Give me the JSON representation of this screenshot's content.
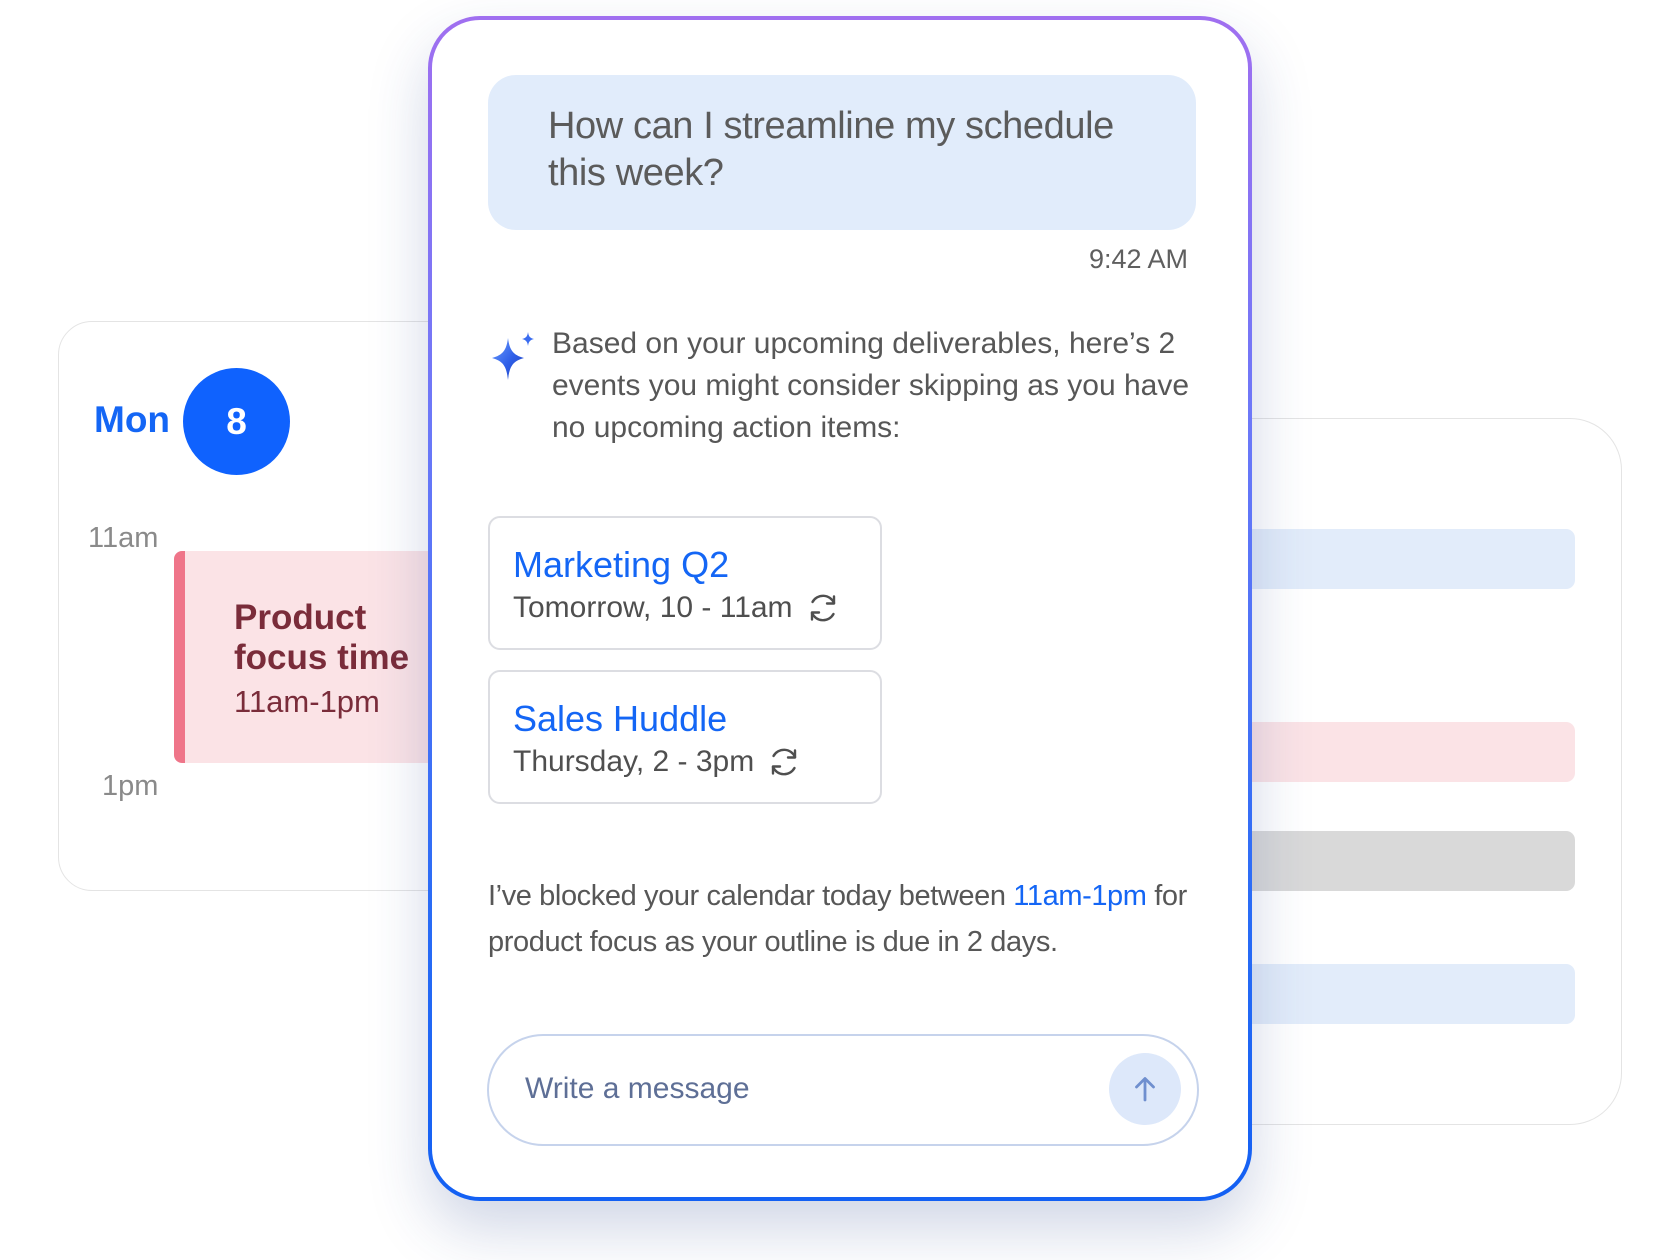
{
  "calendar": {
    "day_name": "Mon",
    "day_number": "8",
    "time_start": "11am",
    "time_end": "1pm",
    "event": {
      "title": "Product focus time",
      "time": "11am-1pm",
      "accent_color": "#ef7589",
      "background_color": "#fbe3e6"
    }
  },
  "chat": {
    "user_message": "How can I streamline my schedule this week?",
    "user_message_time": "9:42 AM",
    "assistant_icon": "sparkle-icon",
    "assistant_message": "Based on your upcoming deliverables, here’s 2 events you might consider skipping as you have no upcoming action items:",
    "events": [
      {
        "title": "Marketing Q2",
        "when": "Tomorrow, 10 - 11am",
        "icon": "recurring-icon"
      },
      {
        "title": "Sales Huddle",
        "when": "Thursday, 2 - 3pm",
        "icon": "recurring-icon"
      }
    ],
    "blocked_prefix": "I’ve blocked your calendar today between ",
    "blocked_highlight": "11am-1pm",
    "blocked_suffix": " for product focus as your outline is due in 2 days.",
    "input_placeholder": "Write a message",
    "send_icon": "arrow-up-icon"
  },
  "colors": {
    "brand_blue": "#1466f5",
    "badge_blue": "#0f62fe",
    "bubble_bg": "#e1ecfb",
    "week_bar_blue": "#e2ecfa",
    "week_bar_pink": "#fbe3e6",
    "week_bar_gray": "#d9d9d9"
  }
}
